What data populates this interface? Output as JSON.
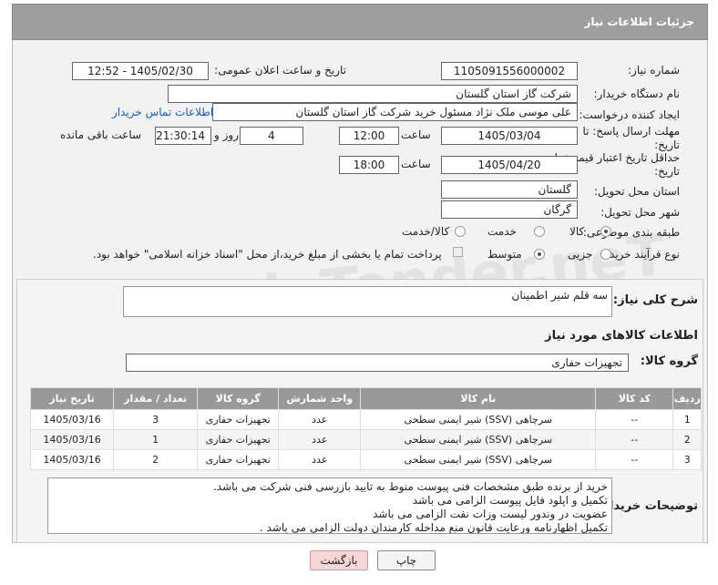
{
  "header_title": "جزئیات اطلاعات نیاز",
  "fields": {
    "need_number_label": "شماره نیاز:",
    "need_number": "1105091556000002",
    "announce_label": "تاریخ و ساعت اعلان عمومی:",
    "announce_value": "1405/02/30 - 12:52",
    "buyer_org_label": "نام دستگاه خریدار:",
    "buyer_org": "شرکت گاز استان گلستان",
    "creator_label": "ایجاد کننده درخواست:",
    "creator": "علی موسی ملک نژاد مسئول خرید شرکت گاز استان گلستان",
    "contact_link": "اطلاعات تماس خریدار",
    "deadline_label": "مهلت ارسال پاسخ: تا تاریخ:",
    "deadline_date": "1405/03/04",
    "time_label": "ساعت",
    "deadline_time": "12:00",
    "days_value": "4",
    "days_label": "روز و",
    "remaining_time": "21:30:14",
    "remaining_label": "ساعت باقی مانده",
    "price_label": "حداقل تاریخ اعتبار قیمت: تا تاریخ:",
    "price_date": "1405/04/20",
    "price_time": "18:00",
    "province_label": "استان محل تحویل:",
    "province": "گلستان",
    "city_label": "شهر محل تحویل:",
    "city": "گرگان",
    "category_label": "طبقه بندی موضوعی:",
    "cat_goods": "کالا",
    "cat_service": "خدمت",
    "cat_both": "کالا/خدمت",
    "process_label": "نوع فرآیند خرید :",
    "proc_minor": "جزیی",
    "proc_medium": "متوسط",
    "payment_note": "پرداخت تمام یا بخشی از مبلغ خرید،از محل \"اسناد خزانه اسلامی\" خواهد بود."
  },
  "description_label": "شرح کلی نیاز:",
  "description": "سه قلم شیر اطمینان",
  "goods_info_title": "اطلاعات کالاهای مورد نیاز",
  "goods_group_label": "گروه کالا:",
  "goods_group": "تجهیزات حفاری",
  "table": {
    "headers": [
      "ردیف",
      "کد کالا",
      "نام کالا",
      "واحد شمارش",
      "گروه کالا",
      "تعداد / مقدار",
      "تاریخ نیاز"
    ],
    "rows": [
      [
        "1",
        "--",
        "شیر ایمنی سطحی (SSV) سرچاهی",
        "عدد",
        "تجهیزات حفاری",
        "3",
        "1405/03/16"
      ],
      [
        "2",
        "--",
        "شیر ایمنی سطحی (SSV) سرچاهی",
        "عدد",
        "تجهیزات حفاری",
        "1",
        "1405/03/16"
      ],
      [
        "3",
        "--",
        "شیر ایمنی سطحی (SSV) سرچاهی",
        "عدد",
        "تجهیزات حفاری",
        "2",
        "1405/03/16"
      ]
    ]
  },
  "buyer_notes_label": "توضیحات خریدار:",
  "buyer_notes": [
    "خرید از برنده طبق مشخصات فنی پیوست منوط به تایید بازرسی فنی  شرکت می باشد.",
    "تکمیل و اپلود فایل پیوست الزامی می باشد",
    "عضویت در وندور لیست وزات نفت  الزامی می باشد",
    "تکمیل اظهارنامه ورعایت قانون منع مداخله کارمندان دولت الزامی می باشد ."
  ],
  "buttons": {
    "print": "چاپ",
    "back": "بازگشت"
  },
  "watermark": "AriaTender.neT"
}
